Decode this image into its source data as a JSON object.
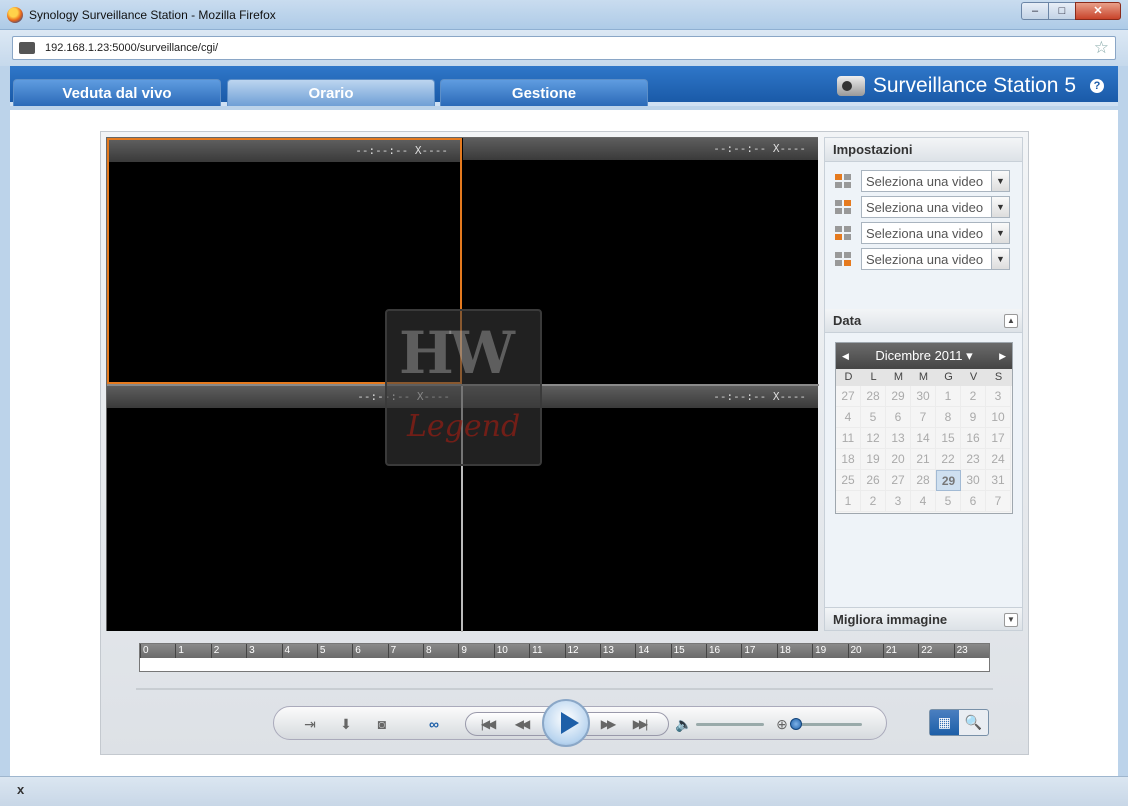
{
  "window": {
    "title": "Synology Surveillance Station - Mozilla Firefox",
    "url": "192.168.1.23:5000/surveillance/cgi/",
    "min_label": "–",
    "max_label": "□",
    "close_label": "✕"
  },
  "tabs": [
    {
      "label": "Veduta dal vivo",
      "active": false
    },
    {
      "label": "Orario",
      "active": true
    },
    {
      "label": "Gestione",
      "active": false
    }
  ],
  "brand": {
    "name": "Surveillance Station 5",
    "help": "?"
  },
  "video_cells": [
    {
      "timestamp": "--:--:-- X----"
    },
    {
      "timestamp": "--:--:-- X----"
    },
    {
      "timestamp": "--:--:-- X----"
    },
    {
      "timestamp": "--:--:-- X----"
    }
  ],
  "watermark": {
    "top": "HW",
    "bottom": "Legend"
  },
  "settings": {
    "title": "Impostazioni",
    "video_selects": [
      {
        "value": "Seleziona una video"
      },
      {
        "value": "Seleziona una video"
      },
      {
        "value": "Seleziona una video"
      },
      {
        "value": "Seleziona una video"
      }
    ]
  },
  "date": {
    "title": "Data",
    "month_label": "Dicembre 2011 ▾",
    "weekdays": [
      "D",
      "L",
      "M",
      "M",
      "G",
      "V",
      "S"
    ],
    "days": [
      "27",
      "28",
      "29",
      "30",
      "1",
      "2",
      "3",
      "4",
      "5",
      "6",
      "7",
      "8",
      "9",
      "10",
      "11",
      "12",
      "13",
      "14",
      "15",
      "16",
      "17",
      "18",
      "19",
      "20",
      "21",
      "22",
      "23",
      "24",
      "25",
      "26",
      "27",
      "28",
      "29",
      "30",
      "31",
      "1",
      "2",
      "3",
      "4",
      "5",
      "6",
      "7"
    ],
    "today_index": 32
  },
  "enhance": {
    "title": "Migliora immagine"
  },
  "timeline": {
    "hours": [
      "0",
      "1",
      "2",
      "3",
      "4",
      "5",
      "6",
      "7",
      "8",
      "9",
      "10",
      "11",
      "12",
      "13",
      "14",
      "15",
      "16",
      "17",
      "18",
      "19",
      "20",
      "21",
      "22",
      "23"
    ]
  },
  "controls": {
    "volume_level": 0.0,
    "zoom_level": 0.0
  },
  "colors": {
    "accent": "#1d5fa8",
    "selected_cell": "#e57a1f"
  },
  "statusbar": {
    "close": "x"
  }
}
